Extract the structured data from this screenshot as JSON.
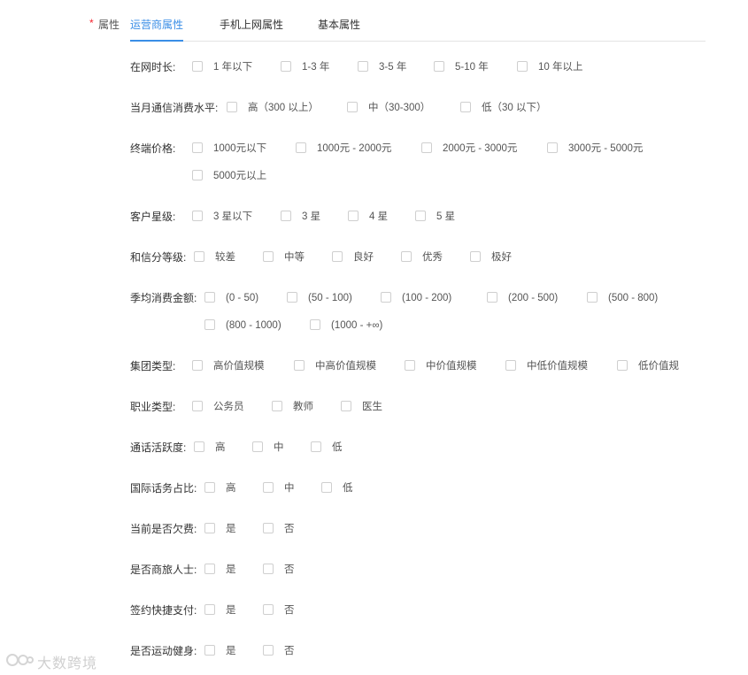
{
  "field": {
    "required_mark": "*",
    "label": "属性"
  },
  "tabs": [
    {
      "label": "运营商属性",
      "active": true
    },
    {
      "label": "手机上网属性",
      "active": false
    },
    {
      "label": "基本属性",
      "active": false
    }
  ],
  "rows": [
    {
      "label": "在网时长:",
      "options": [
        "1 年以下",
        "1-3 年",
        "3-5 年",
        "5-10 年",
        "10 年以上"
      ]
    },
    {
      "label": "当月通信消费水平:",
      "options": [
        "高（300 以上）",
        "中（30-300）",
        "低（30 以下）"
      ]
    },
    {
      "label": "终端价格:",
      "options": [
        "1000元以下",
        "1000元 - 2000元",
        "2000元 - 3000元",
        "3000元 - 5000元",
        "5000元以上"
      ]
    },
    {
      "label": "客户星级:",
      "options": [
        "3 星以下",
        "3 星",
        "4 星",
        "5 星"
      ]
    },
    {
      "label": "和信分等级:",
      "options": [
        "较差",
        "中等",
        "良好",
        "优秀",
        "极好"
      ]
    },
    {
      "label": "季均消费金额:",
      "options": [
        "(0 - 50)",
        "(50 - 100)",
        "(100 - 200)",
        "(200 - 500)",
        "(500 - 800)",
        "(800 - 1000)",
        "(1000 - +∞)"
      ]
    },
    {
      "label": "集团类型:",
      "options": [
        "高价值规模",
        "中高价值规模",
        "中价值规模",
        "中低价值规模",
        "低价值规"
      ]
    },
    {
      "label": "职业类型:",
      "options": [
        "公务员",
        "教师",
        "医生"
      ]
    },
    {
      "label": "通话活跃度:",
      "options": [
        "高",
        "中",
        "低"
      ]
    },
    {
      "label": "国际话务占比:",
      "options": [
        "高",
        "中",
        "低"
      ]
    },
    {
      "label": "当前是否欠费:",
      "options": [
        "是",
        "否"
      ]
    },
    {
      "label": "是否商旅人士:",
      "options": [
        "是",
        "否"
      ]
    },
    {
      "label": "签约快捷支付:",
      "options": [
        "是",
        "否"
      ]
    },
    {
      "label": "是否运动健身:",
      "options": [
        "是",
        "否"
      ]
    }
  ],
  "watermark": {
    "text": "大数跨境"
  },
  "colors": {
    "accent": "#3a8ee6",
    "required": "#f5222d",
    "checkbox_border": "#cfcfcf"
  }
}
